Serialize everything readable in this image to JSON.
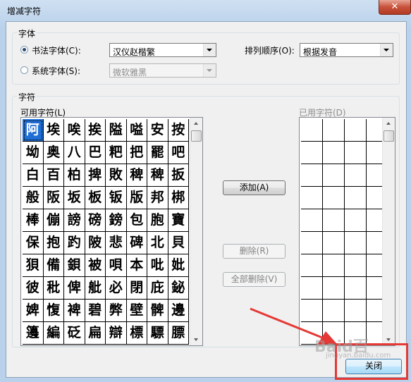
{
  "window": {
    "title": "增减字符",
    "close_glyph": "✕"
  },
  "font_group": {
    "label": "字体",
    "calligraphy_radio": "书法字体(C):",
    "calligraphy_value": "汉仪赵楷繁",
    "system_radio": "系统字体(S):",
    "system_value": "微软雅黑",
    "order_label": "排列顺序(O):",
    "order_value": "根据发音"
  },
  "chars_group": {
    "label": "字符",
    "available_label": "可用字符(L)",
    "used_label": "已用字符(D)",
    "available_chars": [
      "阿",
      "埃",
      "唉",
      "挨",
      "隘",
      "嗌",
      "安",
      "按",
      "坳",
      "奥",
      "八",
      "巴",
      "粑",
      "把",
      "罷",
      "吧",
      "白",
      "百",
      "柏",
      "捭",
      "敗",
      "稗",
      "稗",
      "扳",
      "般",
      "阪",
      "坂",
      "板",
      "钣",
      "版",
      "邦",
      "梆",
      "棒",
      "傰",
      "謗",
      "磅",
      "鎊",
      "包",
      "胞",
      "寶",
      "保",
      "抱",
      "趵",
      "陂",
      "悲",
      "碑",
      "北",
      "貝",
      "狽",
      "備",
      "鋇",
      "被",
      "唄",
      "本",
      "吡",
      "妣",
      "彼",
      "秕",
      "俾",
      "舭",
      "必",
      "閉",
      "庇",
      "鉍",
      "婢",
      "愎",
      "裨",
      "碧",
      "弊",
      "壁",
      "髀",
      "邊",
      "籩",
      "編",
      "砭",
      "扁",
      "辯",
      "標",
      "驃",
      "膘"
    ]
  },
  "buttons": {
    "add": "添加(A)",
    "delete": "删除(R)",
    "delete_all": "全部删除(V)",
    "close": "关闭"
  },
  "watermark": {
    "main": "Baid百",
    "sub": "jingyan.baidu.com"
  }
}
